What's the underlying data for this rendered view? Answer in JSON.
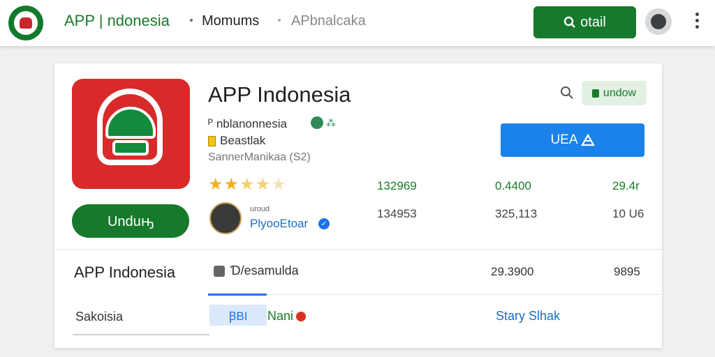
{
  "header": {
    "brand": "APP | ndonesia",
    "breadcrumb_1": "Momums",
    "breadcrumb_2": "APbnalcaka",
    "detail_button": "otail"
  },
  "app": {
    "title": "APP Indonesia",
    "developer": "ᴾ nblanonnesia",
    "badge": "Beastlak",
    "subline": "SannerManikaa  (S2)",
    "install_button": "Unduԣ",
    "download_chip": "undow",
    "primary_action": "UEA",
    "rating": 3.5,
    "stats_row1": [
      "132969",
      "0.4400",
      "29.4r"
    ],
    "stats_row2": [
      "134953",
      "325,113",
      "10 U6"
    ]
  },
  "reviewer": {
    "small_label": "uroud",
    "name": "PlyooEtoar"
  },
  "details_row": {
    "title": "APP Indonesia",
    "category": "Ɗ/esamulda",
    "value_1": "29.3900",
    "value_2": "9895"
  },
  "footer_row": {
    "label": "Sakoisia",
    "tab_chip": "ꞴBI",
    "tag": "Nani",
    "link": "Stary Slhak"
  },
  "colors": {
    "accent_green": "#16792b",
    "primary_blue": "#1a82e8",
    "app_icon_red": "#d82a2a",
    "star": "#f2b01e"
  }
}
